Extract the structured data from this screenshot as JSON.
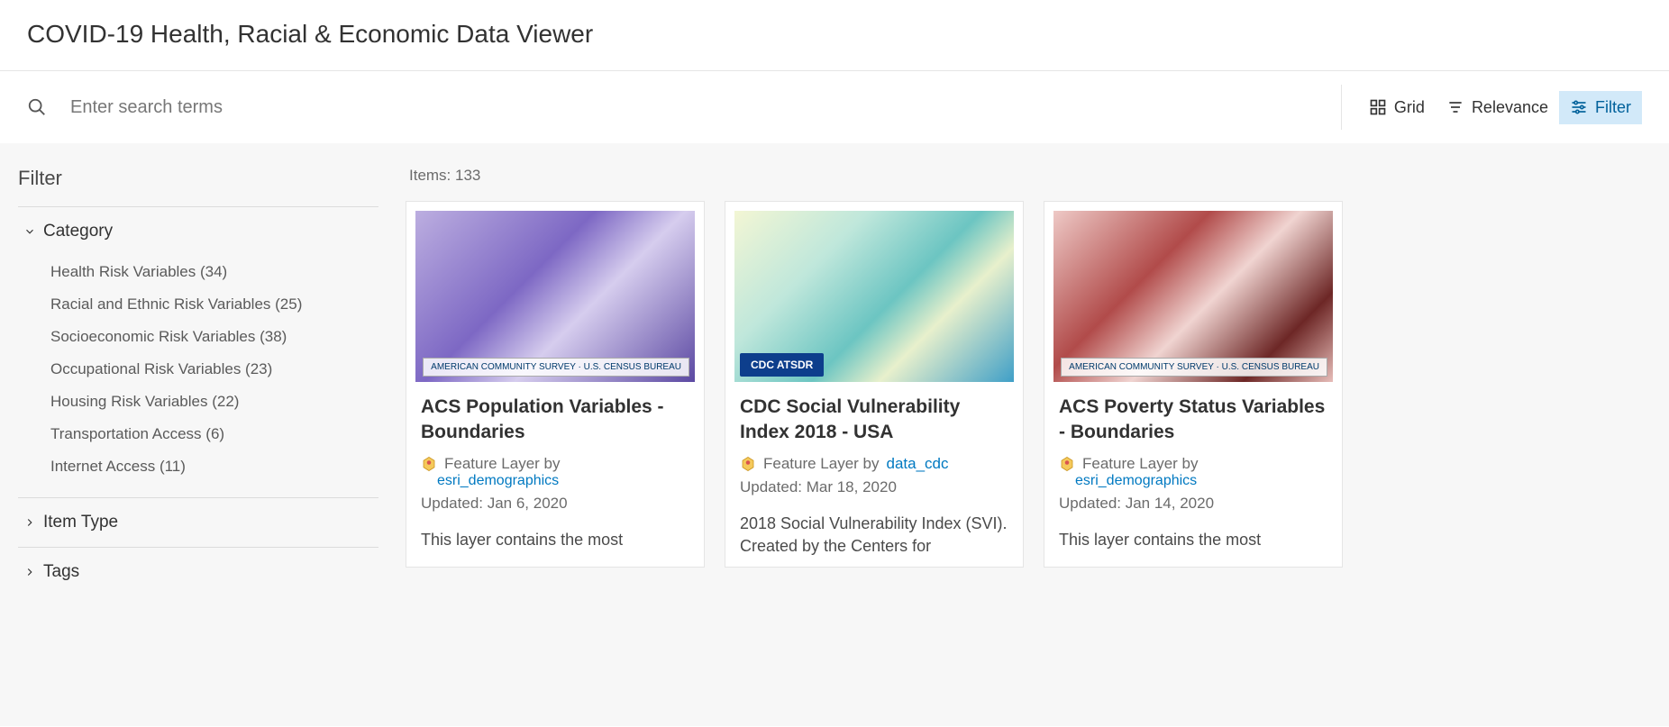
{
  "header": {
    "title": "COVID-19 Health, Racial & Economic Data Viewer"
  },
  "search": {
    "placeholder": "Enter search terms"
  },
  "toolbar": {
    "grid_label": "Grid",
    "sort_label": "Relevance",
    "filter_label": "Filter"
  },
  "sidebar": {
    "title": "Filter",
    "facets": {
      "category": {
        "label": "Category",
        "expanded": true,
        "items": [
          {
            "label": "Health Risk Variables (34)"
          },
          {
            "label": "Racial and Ethnic Risk Variables (25)"
          },
          {
            "label": "Socioeconomic Risk Variables (38)"
          },
          {
            "label": "Occupational Risk Variables (23)"
          },
          {
            "label": "Housing Risk Variables (22)"
          },
          {
            "label": "Transportation Access (6)"
          },
          {
            "label": "Internet Access (11)"
          }
        ]
      },
      "item_type": {
        "label": "Item Type",
        "expanded": false
      },
      "tags": {
        "label": "Tags",
        "expanded": false
      }
    }
  },
  "content": {
    "items_label": "Items: 133",
    "cards": [
      {
        "title": "ACS Population Variables - Boundaries",
        "type_label": "Feature Layer by",
        "author": "esri_demographics",
        "author_inline": false,
        "updated": "Updated: Jan 6, 2020",
        "desc": "This layer contains the most",
        "thumb_class": "map-purple",
        "badge": "AMERICAN COMMUNITY SURVEY · U.S. CENSUS BUREAU"
      },
      {
        "title": "CDC Social Vulnerability Index 2018 - USA",
        "type_label": "Feature Layer by",
        "author": "data_cdc",
        "author_inline": true,
        "updated": "Updated: Mar 18, 2020",
        "desc": "2018 Social Vulnerability Index (SVI). Created by the Centers for",
        "thumb_class": "map-teal",
        "cdc_badge": "CDC  ATSDR"
      },
      {
        "title": "ACS Poverty Status Variables - Boundaries",
        "type_label": "Feature Layer by",
        "author": "esri_demographics",
        "author_inline": false,
        "updated": "Updated: Jan 14, 2020",
        "desc": "This layer contains the most",
        "thumb_class": "map-red",
        "badge": "AMERICAN COMMUNITY SURVEY · U.S. CENSUS BUREAU"
      }
    ]
  }
}
